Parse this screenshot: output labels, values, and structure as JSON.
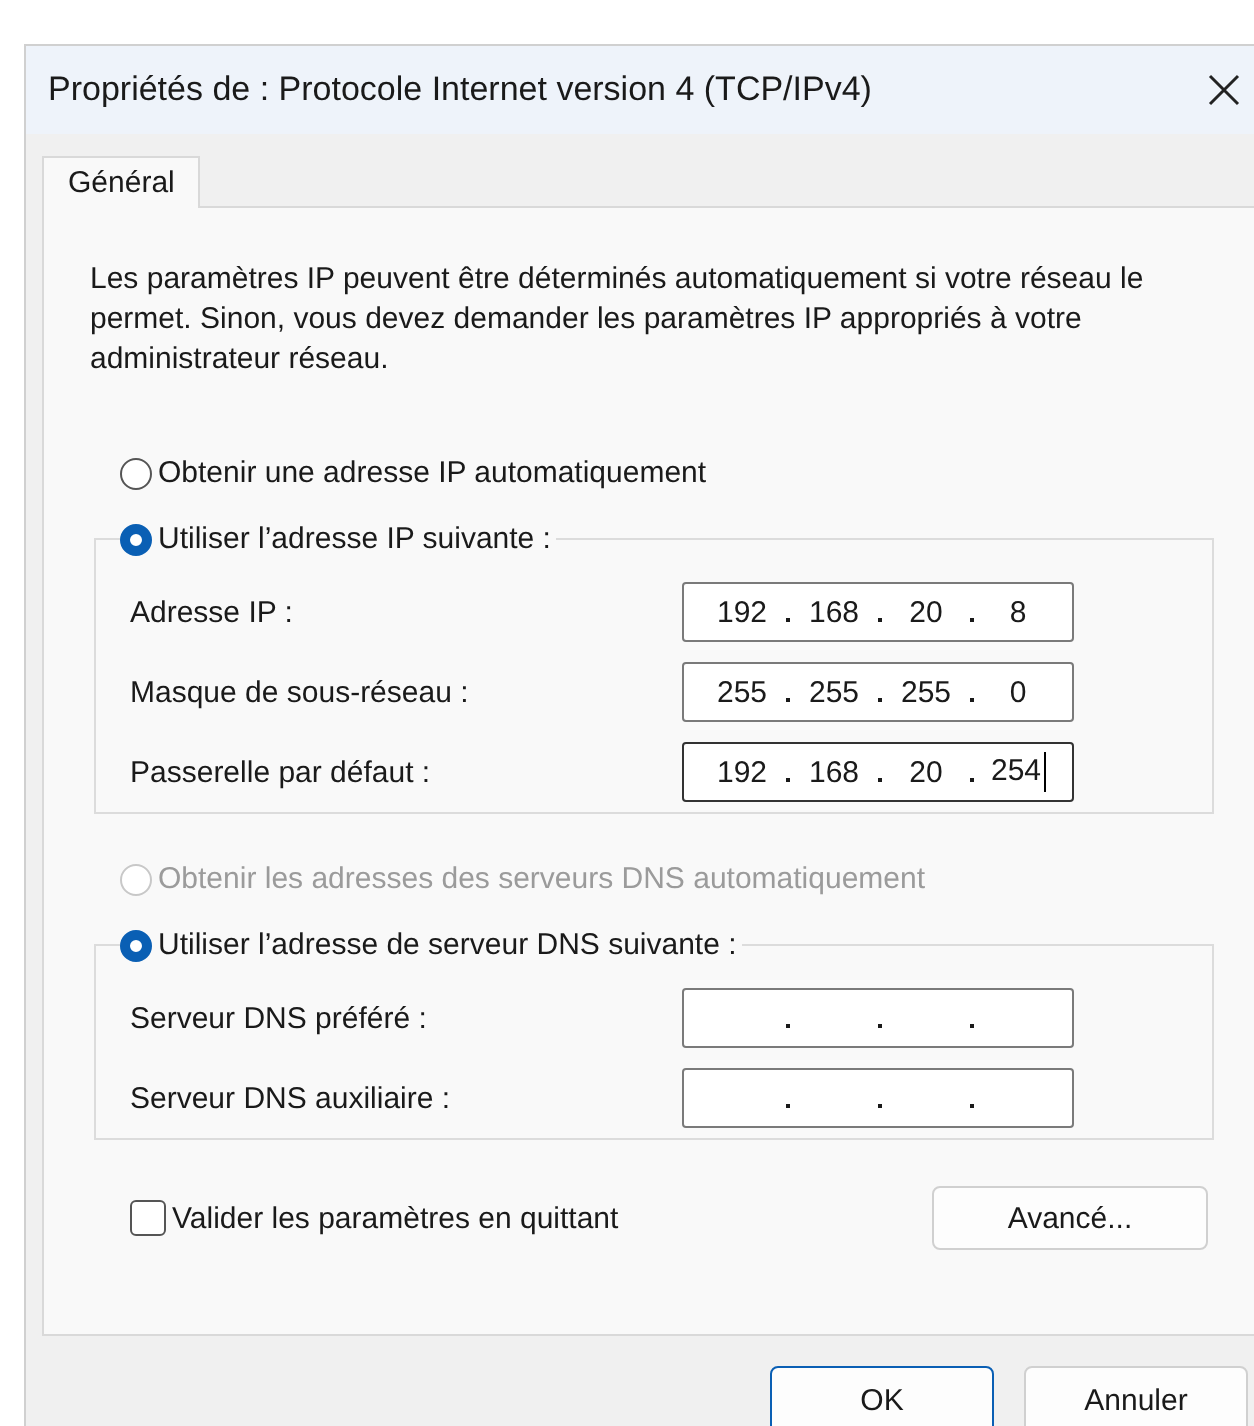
{
  "window": {
    "title": "Propriétés de : Protocole Internet version 4 (TCP/IPv4)"
  },
  "tabs": [
    {
      "label": "Général",
      "selected": true
    }
  ],
  "intro": "Les paramètres IP peuvent être déterminés automatiquement si votre réseau le permet. Sinon, vous devez demander les paramètres IP appropriés à votre administrateur réseau.",
  "ip_settings": {
    "options": [
      {
        "label": "Obtenir une adresse IP automatiquement",
        "selected": false,
        "disabled": false
      },
      {
        "label": "Utiliser l’adresse IP suivante :",
        "selected": true,
        "disabled": false
      }
    ],
    "fields": [
      {
        "label": "Adresse IP :",
        "octets": [
          "192",
          "168",
          "20",
          "8"
        ],
        "focused": false
      },
      {
        "label": "Masque de sous-réseau :",
        "octets": [
          "255",
          "255",
          "255",
          "0"
        ],
        "focused": false
      },
      {
        "label": "Passerelle par défaut :",
        "octets": [
          "192",
          "168",
          "20",
          "254"
        ],
        "focused": true
      }
    ]
  },
  "dns_settings": {
    "options": [
      {
        "label": "Obtenir les adresses des serveurs DNS automatiquement",
        "selected": false,
        "disabled": true
      },
      {
        "label": "Utiliser l’adresse de serveur DNS suivante :",
        "selected": true,
        "disabled": false
      }
    ],
    "fields": [
      {
        "label": "Serveur DNS préféré :",
        "focused": false
      },
      {
        "label": "Serveur DNS auxiliaire :",
        "focused": false
      }
    ]
  },
  "validate_on_exit": {
    "label": "Valider les paramètres en quittant",
    "checked": false
  },
  "advanced_button": "Avancé...",
  "buttons": [
    {
      "label": "OK",
      "default": true
    },
    {
      "label": "Annuler",
      "default": false
    }
  ]
}
